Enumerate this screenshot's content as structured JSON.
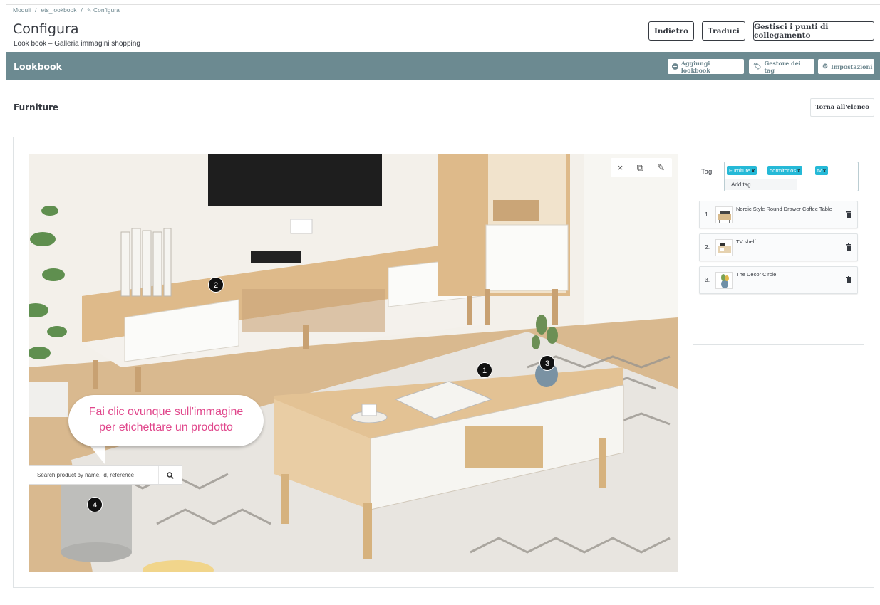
{
  "breadcrumb": {
    "item1": "Moduli",
    "sep": "/",
    "item2": "ets_lookbook",
    "item3": "Configura"
  },
  "header": {
    "title": "Configura",
    "subtitle": "Look book – Galleria immagini shopping",
    "buttons": {
      "back": "Indietro",
      "translate": "Traduci",
      "hooks": "Gestisci i punti di collegamento"
    }
  },
  "lookbook_bar": {
    "title": "Lookbook",
    "add": "Aggiungi lookbook",
    "tags": "Gestore dei tag",
    "settings": "Impostazioni"
  },
  "section": {
    "title": "Furniture",
    "back_to_list": "Torna all'elenco"
  },
  "image": {
    "markers": [
      "1",
      "2",
      "3",
      "4"
    ],
    "hint_line1": "Fai clic ovunque sull'immagine",
    "hint_line2": "per etichettare un prodotto",
    "search_placeholder": "Search product by name, id, reference"
  },
  "tags_panel": {
    "label": "Tag",
    "chips": [
      "Furniture",
      "dormitorios",
      "tv"
    ],
    "chip_remove": "x",
    "add_tag": "Add tag",
    "products": [
      {
        "num": "1.",
        "name": "Nordic Style Round Drawer Coffee Table"
      },
      {
        "num": "2.",
        "name": "TV shelf"
      },
      {
        "num": "3.",
        "name": "The Decor Circle"
      }
    ]
  },
  "colors": {
    "bar": "#6c8a91",
    "chip": "#25b9d7",
    "hint": "#e0468b"
  }
}
